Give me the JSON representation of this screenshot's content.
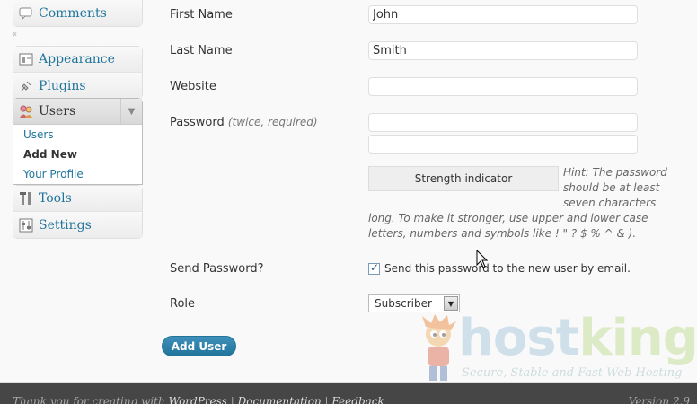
{
  "sidebar": {
    "comments": "Comments",
    "collapse_glyph": "«",
    "appearance": "Appearance",
    "plugins": "Plugins",
    "users_header": "Users",
    "users_sub": [
      "Users",
      "Add New",
      "Your Profile"
    ],
    "tools": "Tools",
    "settings": "Settings"
  },
  "form": {
    "first_name_label": "First Name",
    "first_name_value": "John",
    "last_name_label": "Last Name",
    "last_name_value": "Smith",
    "website_label": "Website",
    "website_value": "",
    "password_label": "Password",
    "password_note": "(twice, required)",
    "strength_label": "Strength indicator",
    "hint_part1": "Hint: The password should be at least seven characters",
    "hint_part2": "long. To make it stronger, use upper and lower case letters, numbers and symbols like ! \" ? $ % ^ & ).",
    "send_password_label": "Send Password?",
    "send_password_text": "Send this password to the new user by email.",
    "send_password_checked": true,
    "role_label": "Role",
    "role_value": "Subscriber",
    "add_user_button": "Add User"
  },
  "logo": {
    "word_part1": "host",
    "word_part2": "king",
    "tagline": "Secure, Stable and Fast Web Hosting"
  },
  "footer": {
    "thanks": "Thank you for creating with",
    "wordpress_link": "WordPress",
    "documentation_link": "Documentation",
    "feedback_link": "Feedback",
    "version": "Version 2.9"
  },
  "colors": {
    "link": "#21759b",
    "button": "#21759b",
    "footer_bg": "#464646"
  }
}
